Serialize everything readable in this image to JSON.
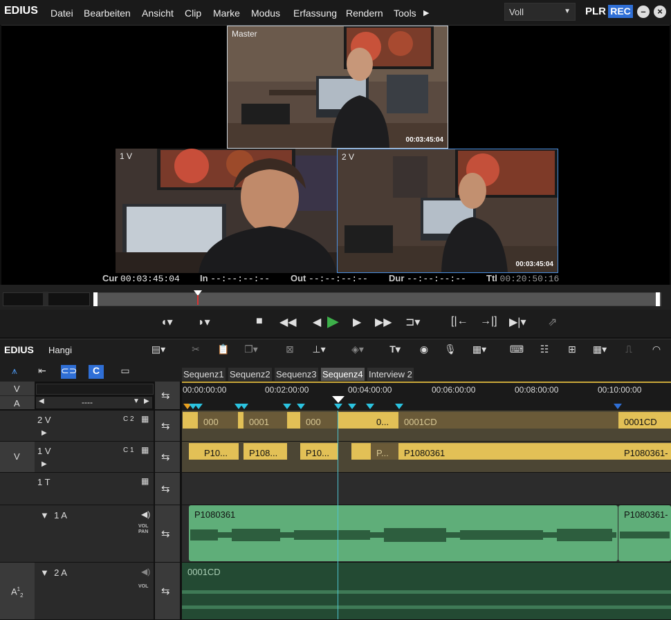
{
  "app": {
    "logo": "EDIUS",
    "project": "Hangi",
    "plr": "PLR",
    "rec": "REC"
  },
  "menu": [
    "Datei",
    "Bearbeiten",
    "Ansicht",
    "Clip",
    "Marke",
    "Modus",
    "Erfassung",
    "Rendern",
    "Tools"
  ],
  "menu_more": "▶",
  "mode_select": {
    "value": "Voll",
    "arrow": "▼"
  },
  "monitor": {
    "master_label": "Master",
    "master_tc": "00:03:45:04",
    "cam1_label": "1 V",
    "cam2_label": "2 V",
    "cam2_tc": "00:03:45:04"
  },
  "timecodes": {
    "cur_label": "Cur",
    "cur": "00:03:45:04",
    "in_label": "In",
    "in": "--:--:--:--",
    "out_label": "Out",
    "out": "--:--:--:--",
    "dur_label": "Dur",
    "dur": "--:--:--:--",
    "ttl_label": "Ttl",
    "ttl": "00:20:50:16"
  },
  "sequence_tabs": [
    "Sequenz1",
    "Sequenz2",
    "Sequenz3",
    "Sequenz4",
    "Interview 2"
  ],
  "active_tab": "Sequenz4",
  "ruler": [
    "00:00:00:00",
    "00:02:00:00",
    "00:04:00:00",
    "00:06:00:00",
    "00:08:00:00",
    "00:10:00:00"
  ],
  "tracks": {
    "v_label": "V",
    "a_label": "A",
    "a_dashes": "----",
    "t2v": {
      "name": "2 V",
      "cam": "C 2"
    },
    "t1v": {
      "name": "1 V",
      "cam": "C 1",
      "side": "V"
    },
    "t1t": {
      "name": "1 T"
    },
    "a1": {
      "name": "1 A",
      "vol": "VOL",
      "pan": "PAN"
    },
    "a2": {
      "name": "2 A",
      "vol": "VOL",
      "side_top": "A",
      "side_sup": "1",
      "side_sub": "2"
    }
  },
  "clips_2v": [
    "000",
    "0001",
    "000",
    "0...",
    "0001CD",
    "0001CD"
  ],
  "clips_1v": [
    "P10...",
    "P108...",
    "P10...",
    "P...",
    "P1080361",
    "P1080361-"
  ],
  "clips_1a": [
    "P1080361",
    "P1080361-"
  ],
  "clips_2a": [
    "0001CD"
  ],
  "colors": {
    "accent": "#2f6fd6",
    "clip_video": "#e2c056",
    "clip_audio": "#5fae79",
    "play": "#3db04a",
    "marker": "#2bc3e0"
  }
}
